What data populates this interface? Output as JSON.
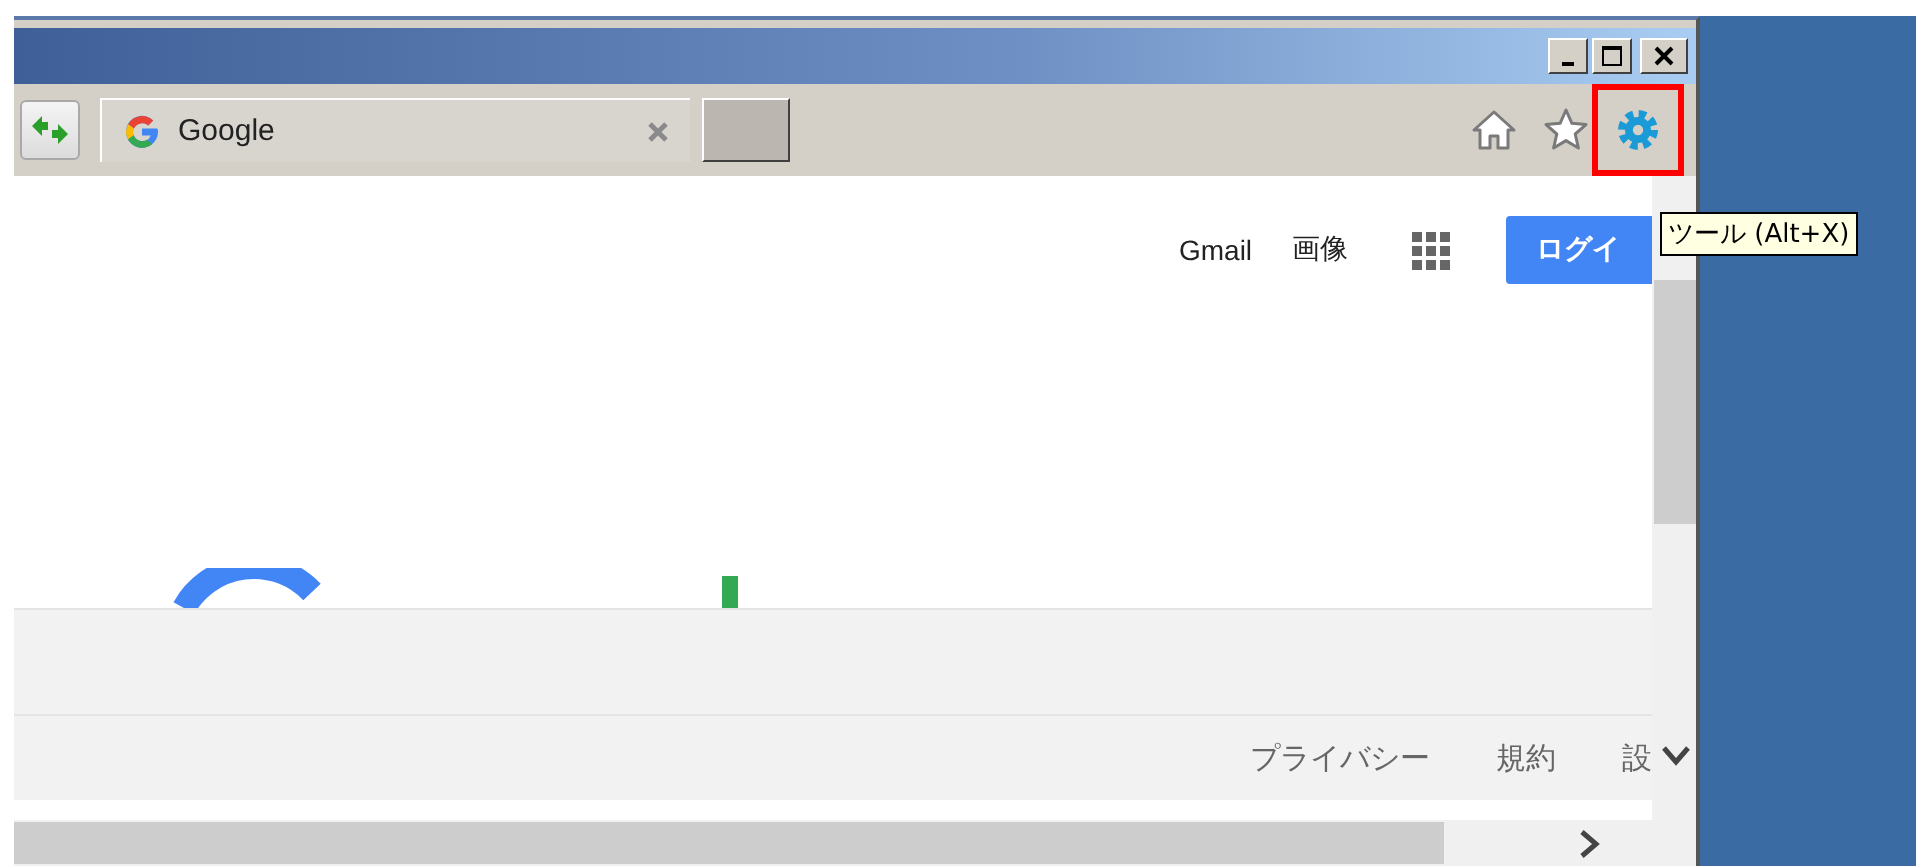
{
  "tab": {
    "title": "Google",
    "selected": true
  },
  "toolbar_icons": [
    {
      "kind": "home",
      "highlighted": false
    },
    {
      "kind": "star",
      "highlighted": false
    },
    {
      "kind": "gear",
      "highlighted": true
    }
  ],
  "tooltip": "ツール (Alt+X)",
  "header_links": [
    "Gmail",
    "画像"
  ],
  "login_button": "ログイ",
  "footer_links": [
    "プライバシー",
    "規約",
    "設"
  ]
}
